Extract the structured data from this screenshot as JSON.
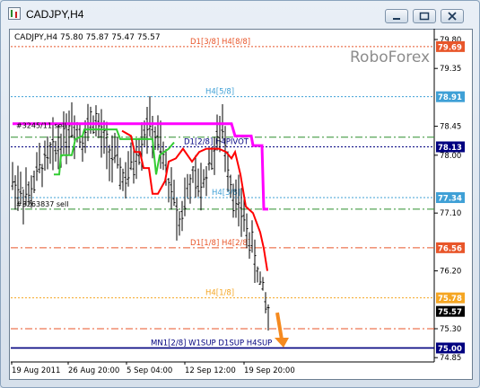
{
  "window": {
    "title": "CADJPY,H4"
  },
  "chart_info": "CADJPY,H4  75.80 75.87 75.47 75.57",
  "watermark": "RoboForex",
  "chart_data": {
    "type": "candlestick",
    "symbol": "CADJPY",
    "timeframe": "H4",
    "ohlc_header": {
      "open": 75.8,
      "high": 75.87,
      "low": 75.47,
      "close": 75.57
    },
    "ylim": [
      74.85,
      79.8
    ],
    "y_ticks": [
      "79.80",
      "79.35",
      "78.45",
      "78.00",
      "77.10",
      "76.20",
      "75.30",
      "74.85"
    ],
    "x_ticks": [
      "19 Aug 2011",
      "26 Aug 20:00",
      "5 Sep 04:00",
      "12 Sep 12:00",
      "19 Sep 20:00"
    ],
    "levels": [
      {
        "label": "D1[3/8] H4[8/8]",
        "price": 79.69,
        "color": "#e8562a",
        "style": "dotted"
      },
      {
        "label": "H4[5/8]",
        "price": 78.91,
        "color": "#3fa0d6",
        "style": "dotted"
      },
      {
        "label": "",
        "price": 78.28,
        "color": "#2f8f2f",
        "style": "dashdot"
      },
      {
        "label": "D1[2/8] H4PIVOT",
        "price": 78.13,
        "color": "#000080",
        "style": "dotted"
      },
      {
        "label": "H4[3/8]",
        "price": 77.34,
        "color": "#3fa0d6",
        "style": "dotted"
      },
      {
        "label": "",
        "price": 77.16,
        "color": "#2f8f2f",
        "style": "dashdot"
      },
      {
        "label": "D1[1/8] H4[2/8]",
        "price": 76.56,
        "color": "#e8562a",
        "style": "dashdot"
      },
      {
        "label": "H4[1/8]",
        "price": 75.78,
        "color": "#f5a623",
        "style": "dotted"
      },
      {
        "label": "",
        "price": 75.3,
        "color": "#e8562a",
        "style": "dashdot"
      },
      {
        "label": "MN1[2/8] W1SUP D1SUP H4SUP",
        "price": 75.0,
        "color": "#00007f",
        "style": "solid"
      }
    ],
    "price_tags": [
      {
        "text": "79.69",
        "bg": "#e8562a",
        "fg": "#ffffff"
      },
      {
        "text": "78.91",
        "bg": "#3fa0d6",
        "fg": "#ffffff"
      },
      {
        "text": "78.13",
        "bg": "#000080",
        "fg": "#ffffff"
      },
      {
        "text": "77.34",
        "bg": "#3fa0d6",
        "fg": "#ffffff"
      },
      {
        "text": "76.56",
        "bg": "#e8562a",
        "fg": "#ffffff"
      },
      {
        "text": "75.78",
        "bg": "#f5a623",
        "fg": "#ffffff"
      },
      {
        "text": "75.57",
        "bg": "#000000",
        "fg": "#ffffff"
      },
      {
        "text": "75.00",
        "bg": "#00007f",
        "fg": "#ffffff"
      }
    ],
    "text_labels": [
      "#3245/11 sell",
      "#3263837 sell"
    ],
    "colors": {
      "magenta": "#ff00ff",
      "red": "#ff0000",
      "green": "#33cc33",
      "arrow": "#f58a1f"
    }
  }
}
